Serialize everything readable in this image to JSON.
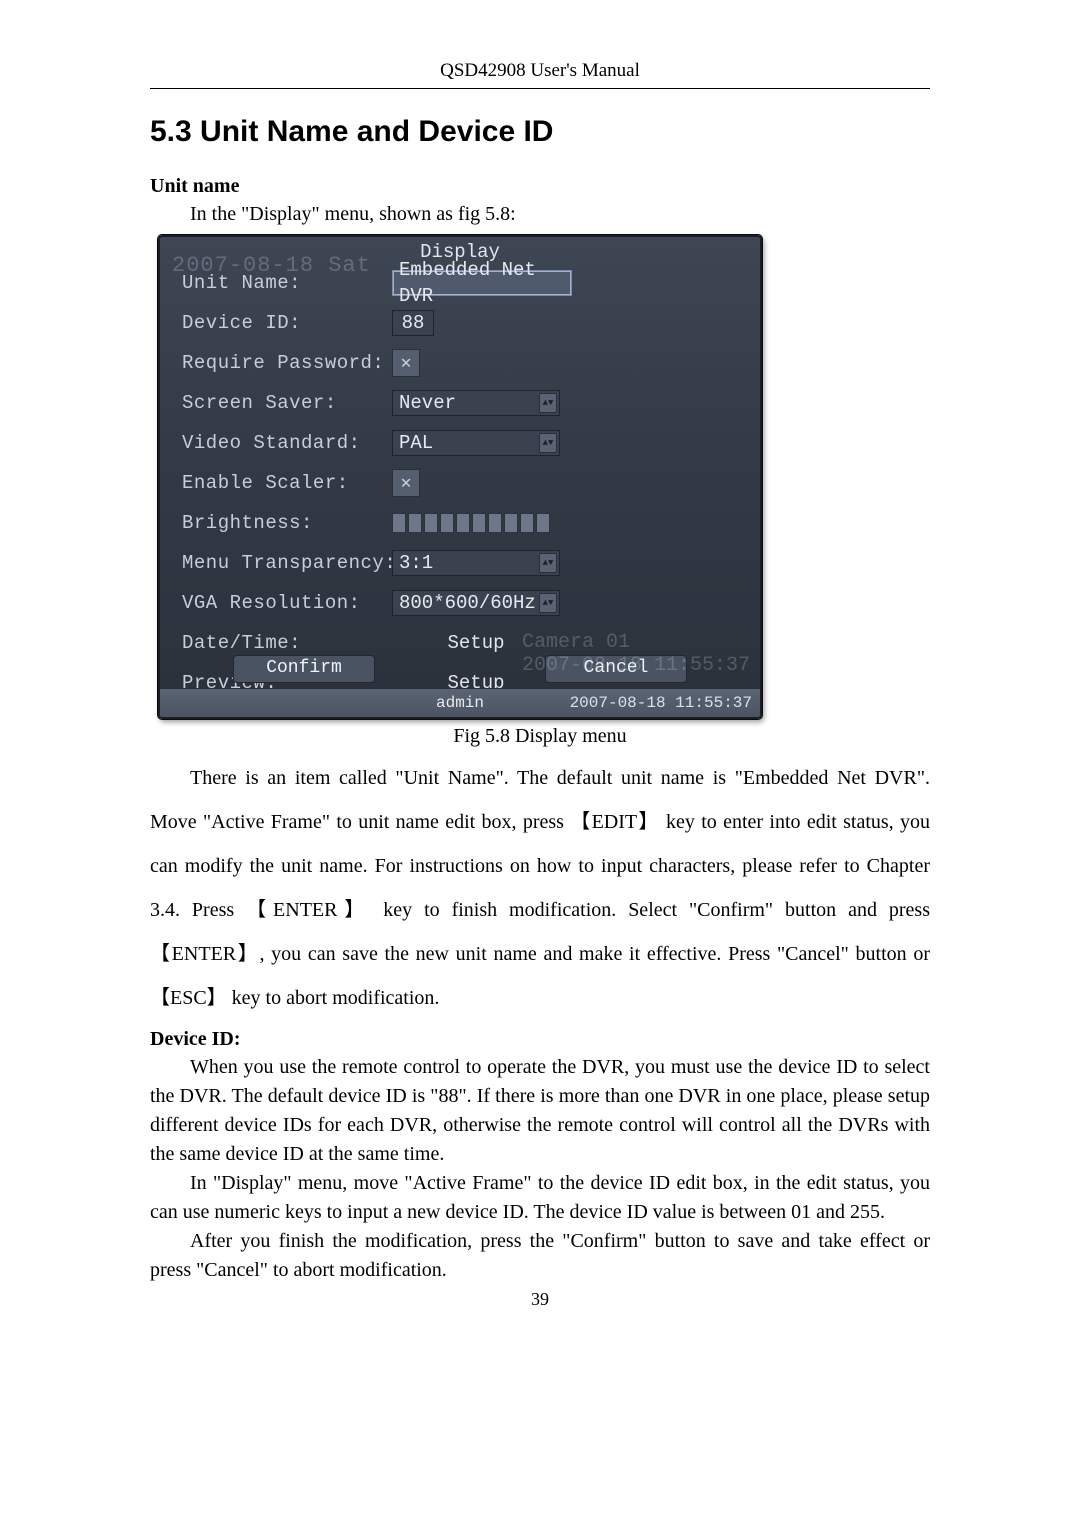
{
  "doc": {
    "header": "QSD42908 User's Manual",
    "section_title": "5.3    Unit Name and Device ID",
    "sub_unit_name": "Unit name",
    "intro_line": "In the \"Display\" menu, shown as fig 5.8:",
    "fig_caption": "Fig 5.8 Display menu",
    "para1": "There is an item called \"Unit Name\". The default unit name is \"Embedded Net DVR\". Move \"Active Frame\" to unit name edit box, press 【EDIT】 key to enter into edit status, you can modify the unit name. For instructions on how to input characters, please refer to Chapter 3.4. Press 【ENTER】 key to finish modification. Select \"Confirm\" button and press 【ENTER】, you can save the new unit name and make it effective. Press \"Cancel\" button or 【ESC】 key to abort modification.",
    "sub_device_id": "Device ID:",
    "para2": "When you use the remote control to operate the DVR, you must use the device ID to select the DVR. The default device ID is \"88\". If there is more than one DVR in one place, please setup different device IDs for each DVR, otherwise the remote control will control all the DVRs with the same device ID at the same time.",
    "para3": "In \"Display\" menu, move \"Active Frame\" to the device ID edit box, in the edit status, you can use numeric keys to input a new device ID. The device ID value is between 01 and 255.",
    "para4": "After you finish the modification, press the \"Confirm\" button to save and take effect or press \"Cancel\" to abort modification.",
    "page_number": "39"
  },
  "shot": {
    "ghost_tl": "2007-08-18 Sat",
    "ghost_br": "Camera 01\n2007-08-18 11:55:37",
    "title": "Display",
    "labels": {
      "unit_name": "Unit Name:",
      "device_id": "Device ID:",
      "require_password": "Require Password:",
      "screen_saver": "Screen Saver:",
      "video_standard": "Video Standard:",
      "enable_scaler": "Enable Scaler:",
      "brightness": "Brightness:",
      "menu_transparency": "Menu Transparency:",
      "vga_resolution": "VGA Resolution:",
      "date_time": "Date/Time:",
      "preview": "Preview:"
    },
    "values": {
      "unit_name": "Embedded Net DVR",
      "device_id": "88",
      "screen_saver": "Never",
      "video_standard": "PAL",
      "menu_transparency": "3:1",
      "vga_resolution": "800*600/60Hz",
      "date_time": "Setup",
      "preview": "Setup"
    },
    "buttons": {
      "confirm": "Confirm",
      "cancel": "Cancel"
    },
    "status": {
      "user": "admin",
      "timestamp": "2007-08-18 11:55:37"
    }
  }
}
